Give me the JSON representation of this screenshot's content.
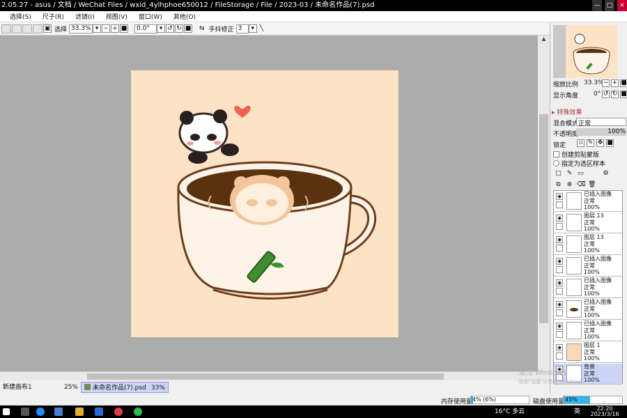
{
  "titlebar": {
    "title": "2.05.27 - asus / 文档 / WeChat Files / wxid_4ylhphoe650012 / FileStorage / File / 2023-03 / 未命名作品(7).psd",
    "btn_min": "—",
    "btn_max": "□",
    "btn_close": "×"
  },
  "menu": [
    "选择(S)",
    "尺子(R)",
    "滤镜(I)",
    "视图(V)",
    "窗口(W)",
    "其他(O)"
  ],
  "toolbar": {
    "select_label": "选择",
    "zoom": "33.3%",
    "angle": "0.0°",
    "stabilizer_label": "手抖修正",
    "stabilizer_value": "3"
  },
  "navigator": {
    "zoom_label": "缩放比例",
    "zoom_value": "33.3%",
    "angle_label": "显示角度",
    "angle_value": "0°"
  },
  "effects": {
    "title": "特殊效果",
    "blend_label": "混合模式",
    "blend_value": "正常",
    "opacity_label": "不透明度",
    "opacity_value": "100%",
    "lock_label": "锁定",
    "clip_label": "创建剪贴蒙版",
    "sample_label": "指定为选区样本"
  },
  "layers": [
    {
      "name": "已插入图像",
      "mode": "正常",
      "opacity": "100%",
      "selected": false,
      "thumb": "#ffffff"
    },
    {
      "name": "图层 13",
      "mode": "正常",
      "opacity": "100%",
      "selected": false,
      "thumb": "#ffffff"
    },
    {
      "name": "图层 13",
      "mode": "正常",
      "opacity": "100%",
      "selected": false,
      "thumb": "#ffffff"
    },
    {
      "name": "已插入图像",
      "mode": "正常",
      "opacity": "100%",
      "selected": false,
      "thumb": "#ffffff"
    },
    {
      "name": "已插入图像",
      "mode": "正常",
      "opacity": "100%",
      "selected": false,
      "thumb": "#ffffff"
    },
    {
      "name": "已插入图像",
      "mode": "正常",
      "opacity": "100%",
      "selected": false,
      "thumb": "#5a3210"
    },
    {
      "name": "已插入图像",
      "mode": "正常",
      "opacity": "100%",
      "selected": false,
      "thumb": "#ffffff"
    },
    {
      "name": "图层 1",
      "mode": "正常",
      "opacity": "100%",
      "selected": false,
      "thumb": "#fcd9b6"
    },
    {
      "name": "背景",
      "mode": "正常",
      "opacity": "100%",
      "selected": true,
      "thumb": "#ffffff"
    }
  ],
  "tabs": [
    {
      "name": "新建画布1",
      "zoom": "25%"
    },
    {
      "name": "未命名作品(7).psd",
      "zoom": "33%"
    }
  ],
  "status": {
    "mem_label": "内存使用量",
    "mem_value": "4% (6%)",
    "mem_fraction": 0.04,
    "disk_label": "磁盘使用量",
    "disk_value": "45%",
    "disk_fraction": 0.45
  },
  "watermark": {
    "line1": "激活 Windows",
    "line2": "转到\"设置\"以激活 Windows。"
  },
  "taskbar": {
    "weather": "16°C 多云",
    "lang": "英",
    "time": "22:20",
    "date": "2023/3/16"
  },
  "colors": {
    "canvas_bg": "#fde3c6",
    "workspace": "#ababab",
    "coffee": "#5a3210",
    "cup": "#fdf3e6",
    "outline": "#6b3b1e",
    "bamboo": "#3f8f2f",
    "heart": "#f0604d",
    "accent": "#33b5e5"
  }
}
